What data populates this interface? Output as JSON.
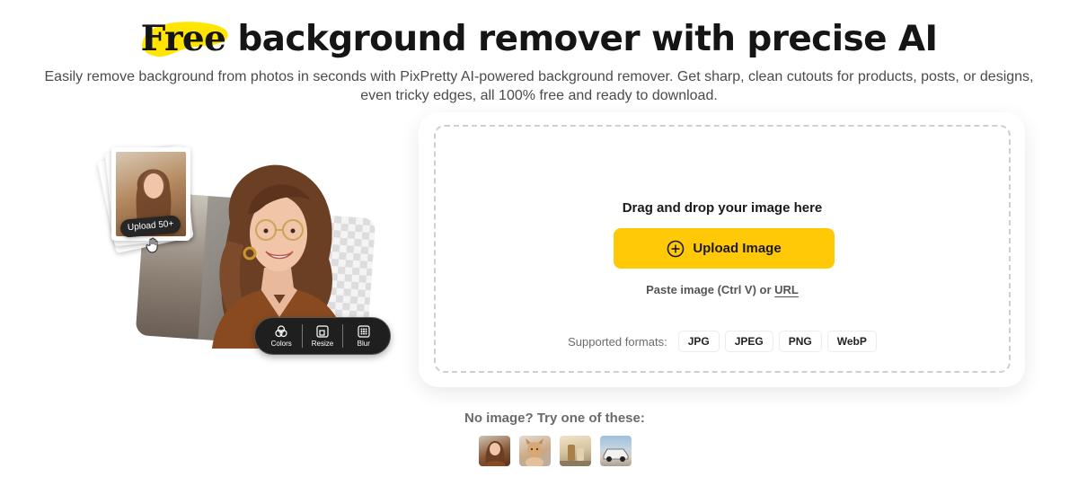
{
  "header": {
    "title_highlight": "Free",
    "title_rest": " background remover with precise AI",
    "subtitle_line1": "Easily remove background from photos in seconds with PixPretty AI-powered background remover. Get sharp, clean cutouts for products, posts, or designs,",
    "subtitle_line2": "even tricky edges, all 100% free and ready to download.",
    "highlight_color": "#ffe500"
  },
  "hero": {
    "upload_chip": "Upload 50+",
    "tools": [
      {
        "label": "Colors",
        "icon": "colors-icon"
      },
      {
        "label": "Resize",
        "icon": "resize-icon"
      },
      {
        "label": "Blur",
        "icon": "blur-icon"
      }
    ]
  },
  "upload": {
    "drop_title": "Drag and drop your image here",
    "button_label": "Upload Image",
    "paste_prefix": "Paste image (Ctrl V) or ",
    "paste_link": "URL",
    "formats_label": "Supported formats:",
    "formats": [
      "JPG",
      "JPEG",
      "PNG",
      "WebP"
    ],
    "accent_color": "#ffc907"
  },
  "samples": {
    "label": "No image? Try one of these:",
    "items": [
      "sample-woman",
      "sample-dog",
      "sample-product",
      "sample-car"
    ]
  }
}
